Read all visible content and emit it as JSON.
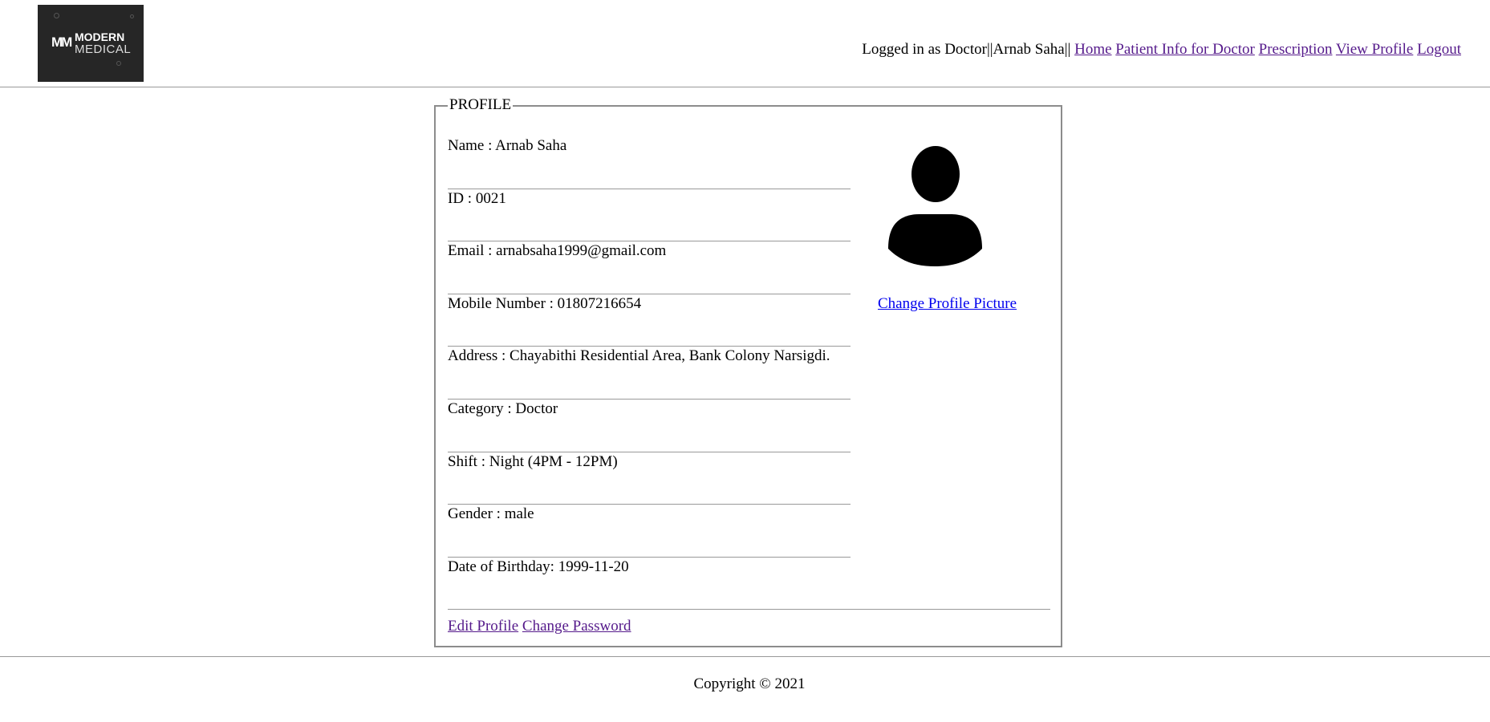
{
  "header": {
    "logo": {
      "line1": "MODERN",
      "line2": "MEDICAL",
      "mark": "MM"
    },
    "logged_in_text": "Logged in as Doctor||Arnab Saha|| ",
    "nav": [
      {
        "label": "Home"
      },
      {
        "label": "Patient Info for Doctor"
      },
      {
        "label": "Prescription"
      },
      {
        "label": "View Profile"
      },
      {
        "label": "Logout"
      }
    ]
  },
  "profile": {
    "legend": "PROFILE",
    "fields": [
      {
        "text": "Name : Arnab Saha"
      },
      {
        "text": "ID : 0021"
      },
      {
        "text": "Email : arnabsaha1999@gmail.com"
      },
      {
        "text": "Mobile Number : 01807216654"
      },
      {
        "text": "Address : Chayabithi Residential Area, Bank Colony Narsigdi."
      },
      {
        "text": "Category : Doctor"
      },
      {
        "text": "Shift : Night (4PM - 12PM)"
      },
      {
        "text": "Gender : male"
      },
      {
        "text": "Date of Birthday: 1999-11-20"
      }
    ],
    "change_picture_label": "Change Profile Picture",
    "edit_profile_label": "Edit Profile",
    "change_password_label": "Change Password"
  },
  "footer": {
    "copyright": "Copyright © 2021"
  },
  "colors": {
    "link_visited": "#551a8b",
    "link": "#0000ee",
    "logo_bg": "#262626"
  },
  "icons": {
    "avatar": "user-silhouette-icon"
  }
}
